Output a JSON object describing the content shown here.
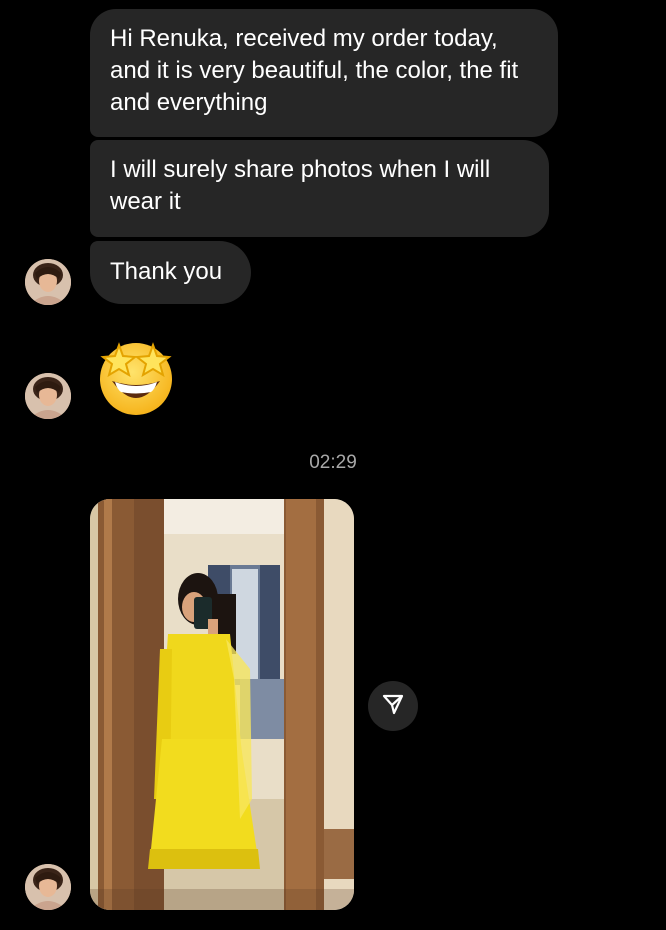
{
  "messages": [
    {
      "type": "text",
      "text": "Hi Renuka, received my order today, and it is very beautiful, the color, the fit and everything"
    },
    {
      "type": "text",
      "text": "I will surely share photos when I will wear it"
    },
    {
      "type": "text",
      "text": "Thank you"
    },
    {
      "type": "emoji",
      "emoji_name": "star-struck",
      "emoji": "🤩"
    },
    {
      "type": "timestamp",
      "text": "02:29"
    },
    {
      "type": "photo",
      "description_icon": "photo-mirror-selfie"
    }
  ],
  "icons": {
    "share": "paper-plane-icon",
    "avatar": "sender-avatar"
  },
  "colors": {
    "background": "#000000",
    "bubble": "#262626",
    "text": "#ffffff",
    "timestamp": "#a8a8a8",
    "dress": "#f2dc1e"
  }
}
